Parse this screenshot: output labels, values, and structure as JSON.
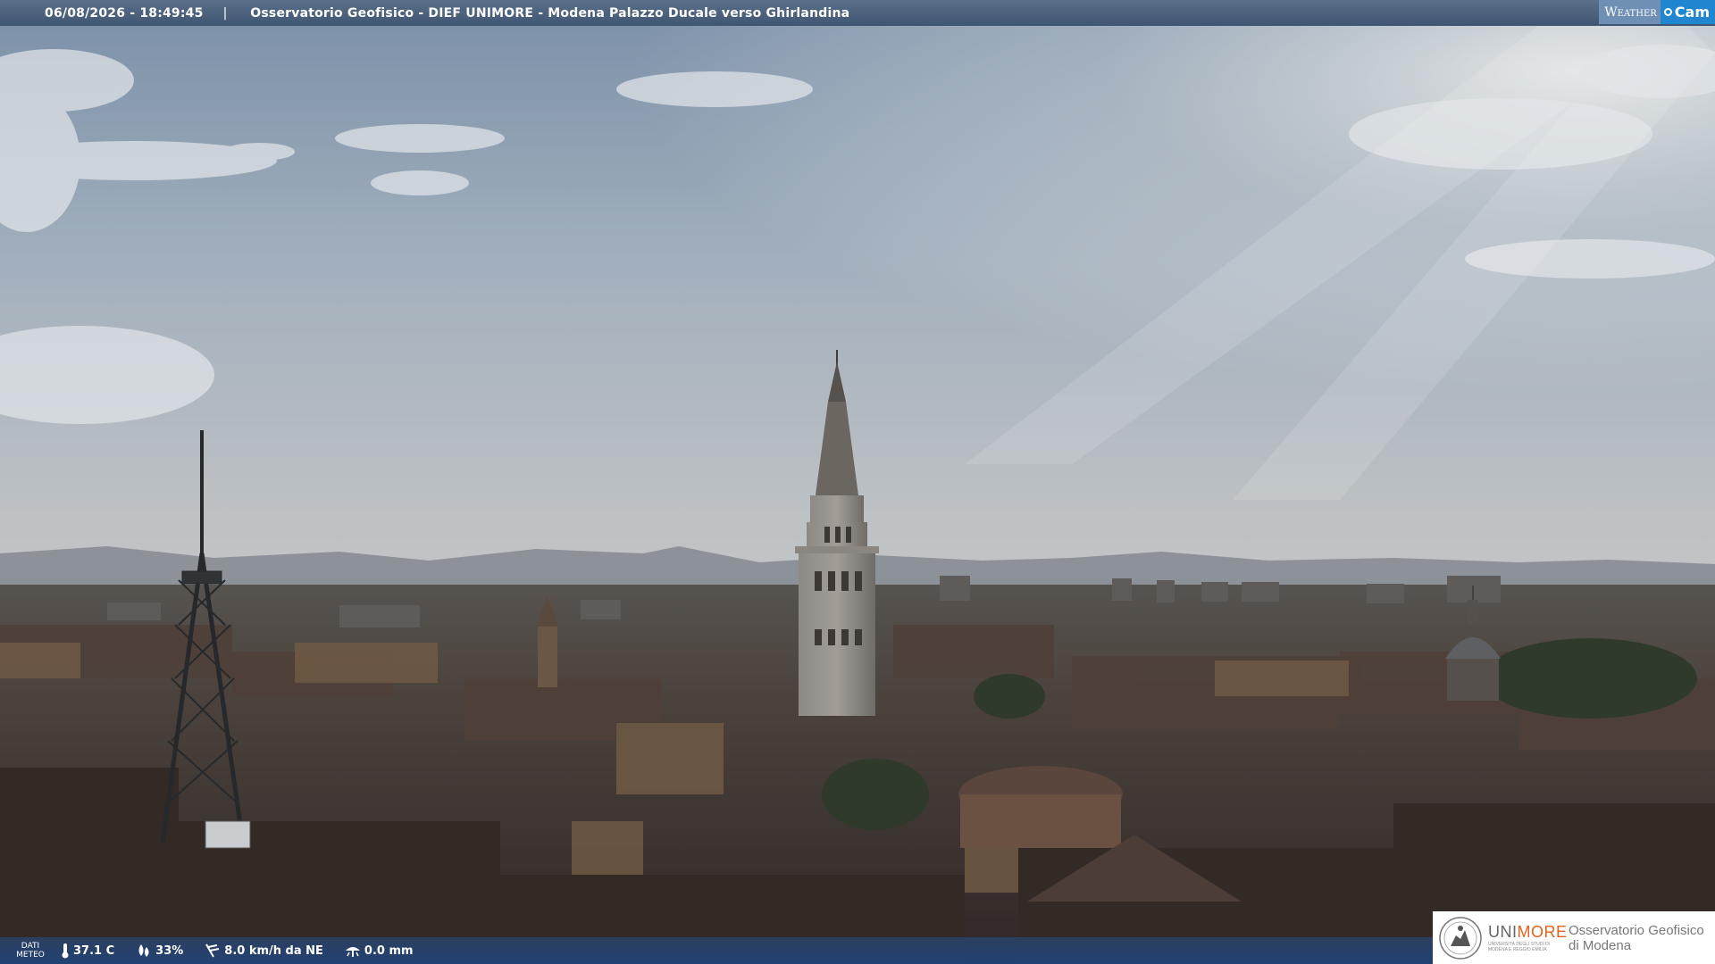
{
  "overlay": {
    "timestamp": "06/08/2026 - 18:49:45",
    "separator": "|",
    "title": "Osservatorio Geofisico - DIEF UNIMORE - Modena Palazzo Ducale verso Ghirlandina",
    "logo_weather": "Weather",
    "logo_cam": "Cam"
  },
  "weather": {
    "label_line1": "DATI",
    "label_line2": "METEO",
    "temperature": "37.1 C",
    "humidity": "33%",
    "wind": "8.0 km/h da NE",
    "rain": "0.0 mm",
    "icons": [
      "thermometer-icon",
      "humidity-icon",
      "wind-icon",
      "rain-gauge-icon"
    ]
  },
  "branding": {
    "uni_name_a": "UNI",
    "uni_name_b": "MORE",
    "uni_sub_line1": "UNIVERSITÀ DEGLI STUDI DI",
    "uni_sub_line2": "MODENA E REGGIO EMILIA",
    "observatory_line1": "Osservatorio Geofisico",
    "observatory_line2": "di Modena",
    "accent_color": "#e2641e"
  },
  "scene": {
    "subjects": [
      "Torre Ghirlandina",
      "Modena skyline",
      "radio antenna tower",
      "Apennine mountains",
      "dome of San Vincenzo"
    ],
    "sky_color": "#8fa3b9",
    "roof_color": "#4a3a32"
  }
}
